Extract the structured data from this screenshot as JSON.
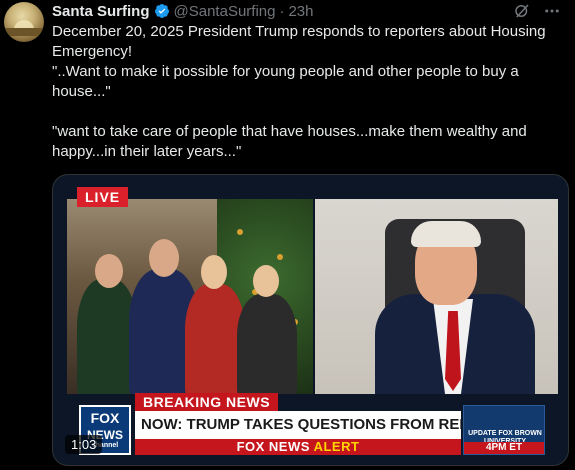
{
  "post": {
    "author_name": "Santa Surfing",
    "handle": "@SantaSurfing",
    "separator": "·",
    "time": "23h",
    "lines": [
      "December 20, 2025 President Trump responds to reporters about Housing Emergency!",
      "\"..Want to make it possible for young people and other people to buy a house...\"",
      "\"want to take care of people that have houses...make them wealthy and happy...in their later years...\""
    ]
  },
  "video": {
    "live_label": "LIVE",
    "breaking_label": "BREAKING NEWS",
    "headline": "NOW: TRUMP TAKES QUESTIONS FROM REPORTERS AT WH",
    "alert_part1": "FOX NEWS",
    "alert_part2": "ALERT",
    "logo_line1": "FOX",
    "logo_line2": "NEWS",
    "logo_line3": "channel",
    "promo_text": "UPDATE FOX BROWN UNIVERSITY SHOOTING",
    "promo_time": "4PM ET",
    "duration": "1:03"
  },
  "colors": {
    "verified_badge": "#1d9bf0",
    "muted_text": "#71767b",
    "fox_red": "#c4161c"
  },
  "icons": [
    "verified-badge-icon",
    "grok-icon",
    "more-options-icon"
  ]
}
